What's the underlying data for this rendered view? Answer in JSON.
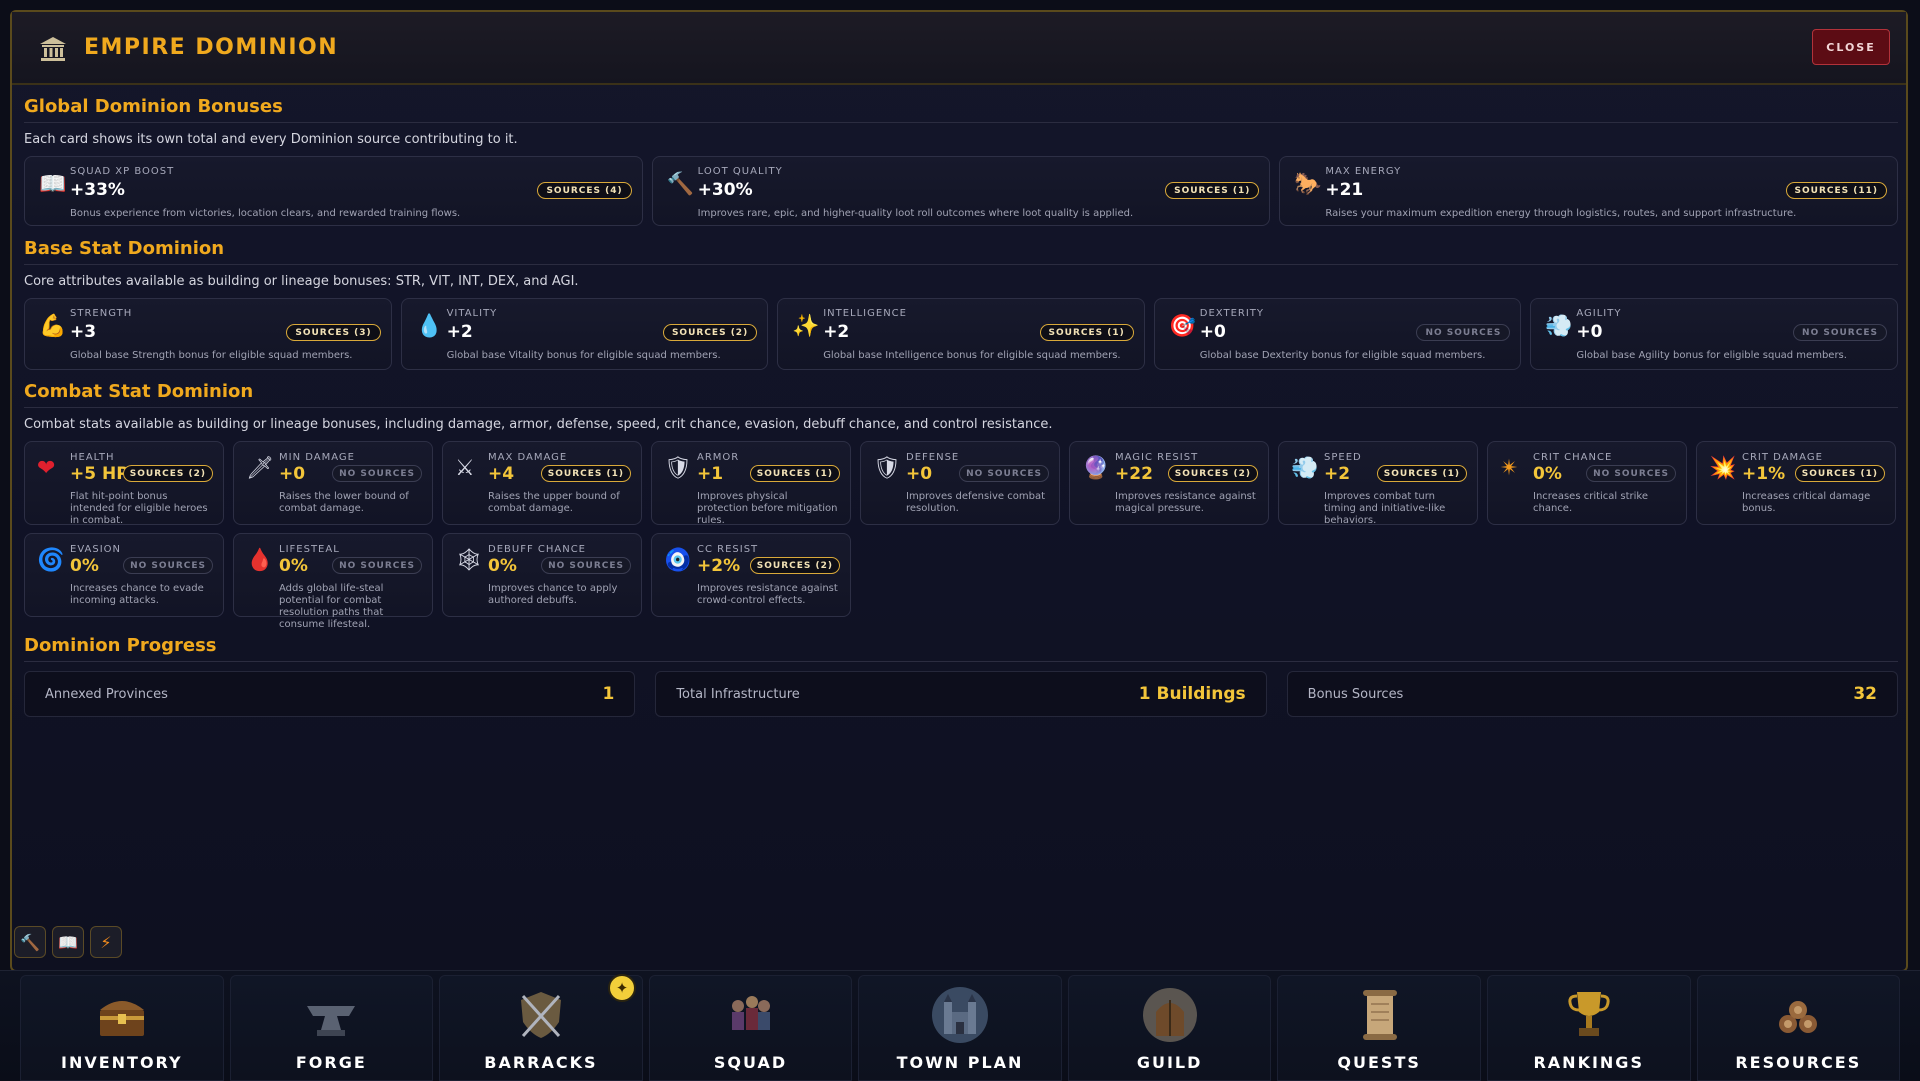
{
  "header": {
    "title": "EMPIRE DOMINION",
    "close_label": "CLOSE"
  },
  "global": {
    "title": "Global Dominion Bonuses",
    "desc": "Each card shows its own total and every Dominion source contributing to it.",
    "cards": [
      {
        "label": "SQUAD XP BOOST",
        "value": "+33%",
        "sources": "SOURCES (4)",
        "desc": "Bonus experience from victories, location clears, and rewarded training flows.",
        "icon": "book-icon"
      },
      {
        "label": "LOOT QUALITY",
        "value": "+30%",
        "sources": "SOURCES (1)",
        "desc": "Improves rare, epic, and higher-quality loot roll outcomes where loot quality is applied.",
        "icon": "hammer-icon"
      },
      {
        "label": "MAX ENERGY",
        "value": "+21",
        "sources": "SOURCES (11)",
        "desc": "Raises your maximum expedition energy through logistics, routes, and support infrastructure.",
        "icon": "horse-icon"
      }
    ]
  },
  "base": {
    "title": "Base Stat Dominion",
    "desc": "Core attributes available as building or lineage bonuses: STR, VIT, INT, DEX, and AGI.",
    "cards": [
      {
        "label": "STRENGTH",
        "value": "+3",
        "sources": "SOURCES (3)",
        "desc": "Global base Strength bonus for eligible squad members."
      },
      {
        "label": "VITALITY",
        "value": "+2",
        "sources": "SOURCES (2)",
        "desc": "Global base Vitality bonus for eligible squad members."
      },
      {
        "label": "INTELLIGENCE",
        "value": "+2",
        "sources": "SOURCES (1)",
        "desc": "Global base Intelligence bonus for eligible squad members."
      },
      {
        "label": "DEXTERITY",
        "value": "+0",
        "sources": "NO SOURCES",
        "desc": "Global base Dexterity bonus for eligible squad members."
      },
      {
        "label": "AGILITY",
        "value": "+0",
        "sources": "NO SOURCES",
        "desc": "Global base Agility bonus for eligible squad members."
      }
    ]
  },
  "combat": {
    "title": "Combat Stat Dominion",
    "desc": "Combat stats available as building or lineage bonuses, including damage, armor, defense, speed, crit chance, evasion, debuff chance, and control resistance.",
    "cards": [
      {
        "label": "HEALTH",
        "value": "+5 HP",
        "sources": "SOURCES (2)",
        "desc": "Flat hit-point bonus intended for eligible heroes in combat."
      },
      {
        "label": "MIN DAMAGE",
        "value": "+0",
        "sources": "NO SOURCES",
        "desc": "Raises the lower bound of combat damage."
      },
      {
        "label": "MAX DAMAGE",
        "value": "+4",
        "sources": "SOURCES (1)",
        "desc": "Raises the upper bound of combat damage."
      },
      {
        "label": "ARMOR",
        "value": "+1",
        "sources": "SOURCES (1)",
        "desc": "Improves physical protection before mitigation rules."
      },
      {
        "label": "DEFENSE",
        "value": "+0",
        "sources": "NO SOURCES",
        "desc": "Improves defensive combat resolution."
      },
      {
        "label": "MAGIC RESIST",
        "value": "+22",
        "sources": "SOURCES (2)",
        "desc": "Improves resistance against magical pressure."
      },
      {
        "label": "SPEED",
        "value": "+2",
        "sources": "SOURCES (1)",
        "desc": "Improves combat turn timing and initiative-like behaviors."
      },
      {
        "label": "CRIT CHANCE",
        "value": "0%",
        "sources": "NO SOURCES",
        "desc": "Increases critical strike chance."
      },
      {
        "label": "CRIT DAMAGE",
        "value": "+1%",
        "sources": "SOURCES (1)",
        "desc": "Increases critical damage bonus."
      },
      {
        "label": "EVASION",
        "value": "0%",
        "sources": "NO SOURCES",
        "desc": "Increases chance to evade incoming attacks."
      },
      {
        "label": "LIFESTEAL",
        "value": "0%",
        "sources": "NO SOURCES",
        "desc": "Adds global life-steal potential for combat resolution paths that consume lifesteal."
      },
      {
        "label": "DEBUFF CHANCE",
        "value": "0%",
        "sources": "NO SOURCES",
        "desc": "Improves chance to apply authored debuffs."
      },
      {
        "label": "CC RESIST",
        "value": "+2%",
        "sources": "SOURCES (2)",
        "desc": "Improves resistance against crowd-control effects."
      }
    ]
  },
  "progress": {
    "title": "Dominion Progress",
    "items": [
      {
        "label": "Annexed Provinces",
        "value": "1"
      },
      {
        "label": "Total Infrastructure",
        "value": "1 Buildings"
      },
      {
        "label": "Bonus Sources",
        "value": "32"
      }
    ]
  },
  "nav": [
    "INVENTORY",
    "FORGE",
    "BARRACKS",
    "SQUAD",
    "TOWN PLAN",
    "GUILD",
    "QUESTS",
    "RANKINGS",
    "RESOURCES"
  ],
  "colors": {
    "accent": "#f0a91e",
    "value": "#f3c53a",
    "close": "#5c0c14"
  }
}
